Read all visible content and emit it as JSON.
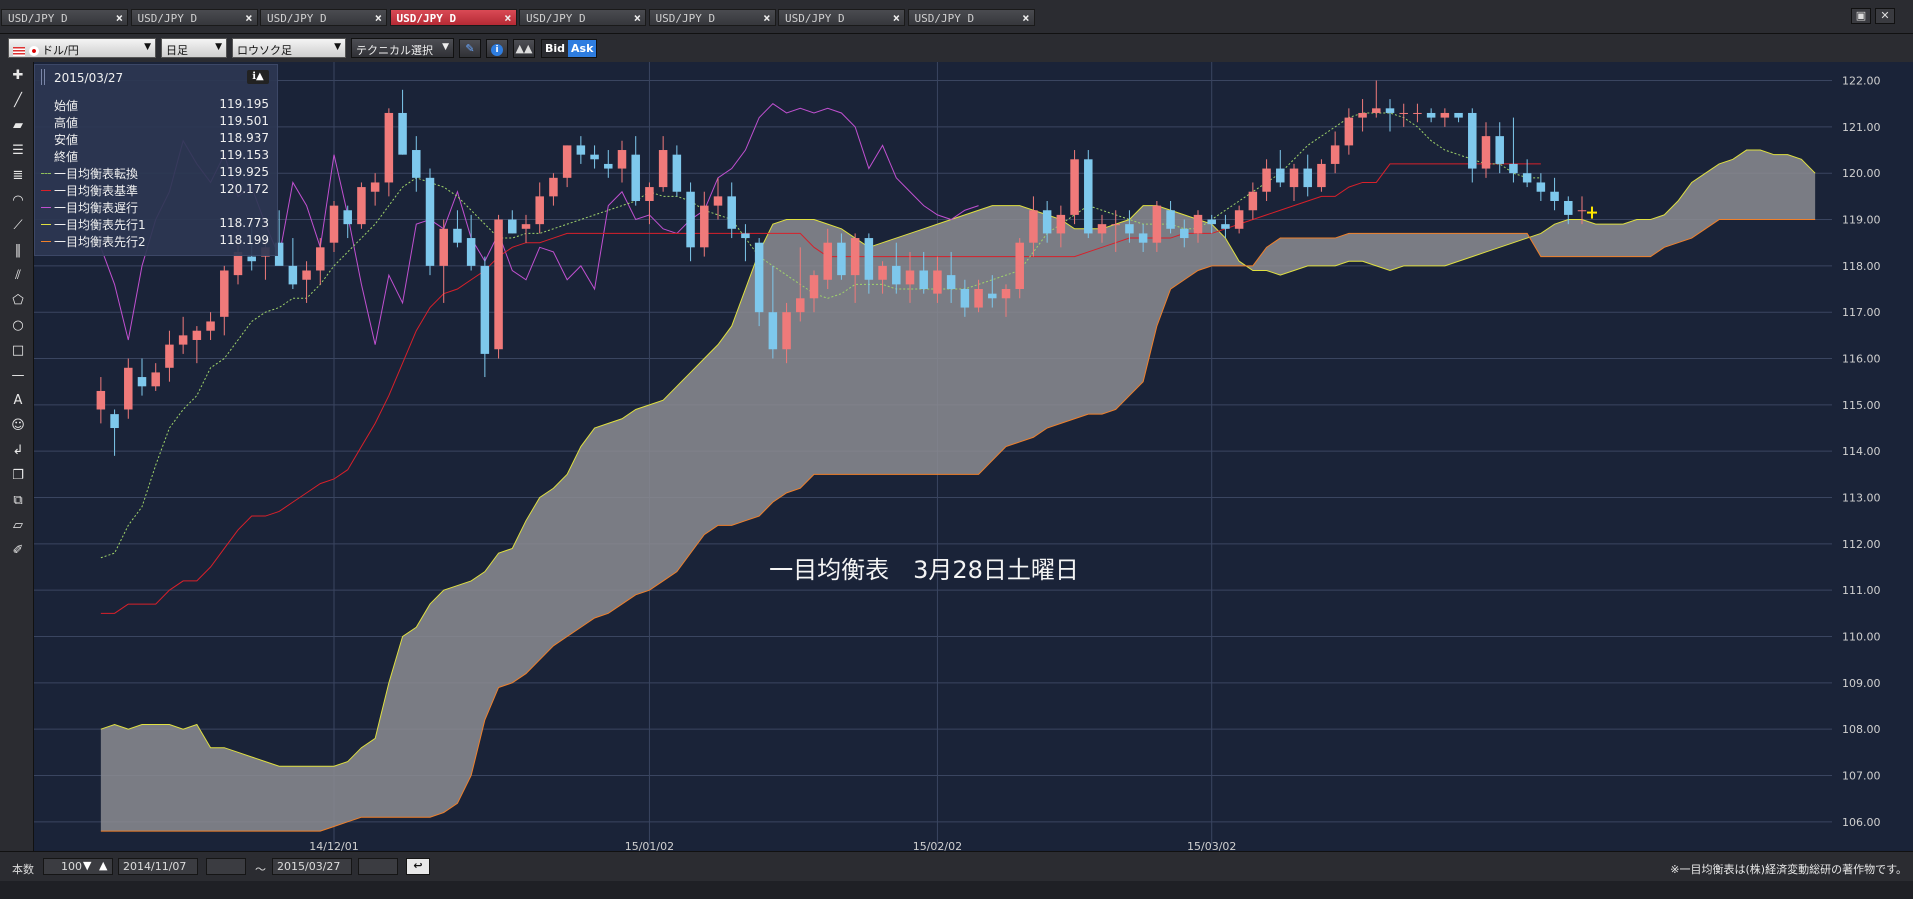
{
  "tabs": [
    {
      "label": "USD/JPY D",
      "active": false
    },
    {
      "label": "USD/JPY D",
      "active": false
    },
    {
      "label": "USD/JPY D",
      "active": false
    },
    {
      "label": "USD/JPY D",
      "active": true
    },
    {
      "label": "USD/JPY D",
      "active": false
    },
    {
      "label": "USD/JPY D",
      "active": false
    },
    {
      "label": "USD/JPY D",
      "active": false
    },
    {
      "label": "USD/JPY D",
      "active": false
    }
  ],
  "toolbar": {
    "currency": "ドル/円",
    "period": "日足",
    "chart_style": "ロウソク足",
    "technical": "テクニカル選択",
    "bid": "Bid",
    "ask": "Ask"
  },
  "info_panel": {
    "date": "2015/03/27",
    "rows": [
      {
        "label": "始値",
        "value": "119.195"
      },
      {
        "label": "高値",
        "value": "119.501"
      },
      {
        "label": "安値",
        "value": "118.937"
      },
      {
        "label": "終値",
        "value": "119.153"
      },
      {
        "label": "一目均衡表転換",
        "value": "119.925"
      },
      {
        "label": "一目均衡表基準",
        "value": "120.172"
      },
      {
        "label": "一目均衡表遅行",
        "value": ""
      },
      {
        "label": "一目均衡表先行1",
        "value": "118.773"
      },
      {
        "label": "一目均衡表先行2",
        "value": "118.199"
      }
    ]
  },
  "chart_annotation": "一目均衡表　3月28日土曜日",
  "copyright": "※一目均衡表は(株)経済変動総研の著作物です。",
  "bottom": {
    "count_label": "本数",
    "count_value": "100",
    "date_from": "2014/11/07",
    "tilde": "～",
    "date_to": "2015/03/27"
  },
  "colors": {
    "background": "#1a2338",
    "grid": "#3a4560",
    "bull": "#f07a7a",
    "bear": "#7ec8ec",
    "tenkan": "#9fd36a",
    "kijun": "#d8202a",
    "chikou": "#c050d0",
    "senkou1": "#e0e040",
    "senkou2": "#f0802a",
    "cloud": "#8c8c92"
  },
  "chart_data": {
    "type": "candlestick",
    "y_ticks": [
      "122.00",
      "121.00",
      "120.00",
      "119.00",
      "118.00",
      "117.00",
      "116.00",
      "115.00",
      "114.00",
      "113.00",
      "112.00",
      "111.00",
      "110.00",
      "109.00",
      "108.00",
      "107.00",
      "106.00"
    ],
    "ylim": [
      105.5,
      122.4
    ],
    "x_ticks": [
      {
        "label": "14/12/01",
        "index": 17
      },
      {
        "label": "15/01/02",
        "index": 40
      },
      {
        "label": "15/02/02",
        "index": 61
      },
      {
        "label": "15/03/02",
        "index": 81
      }
    ],
    "total_slots": 126,
    "candles": [
      [
        114.9,
        115.6,
        114.6,
        115.3
      ],
      [
        114.8,
        114.9,
        113.9,
        114.5
      ],
      [
        114.9,
        116.0,
        114.7,
        115.8
      ],
      [
        115.6,
        116.0,
        115.2,
        115.4
      ],
      [
        115.4,
        115.9,
        115.3,
        115.7
      ],
      [
        115.8,
        116.6,
        115.5,
        116.3
      ],
      [
        116.3,
        116.9,
        116.1,
        116.5
      ],
      [
        116.4,
        116.7,
        115.9,
        116.6
      ],
      [
        116.6,
        117.0,
        116.4,
        116.8
      ],
      [
        116.9,
        118.0,
        116.5,
        117.9
      ],
      [
        117.8,
        118.5,
        117.6,
        118.3
      ],
      [
        118.2,
        118.9,
        117.9,
        118.1
      ],
      [
        118.2,
        118.6,
        117.7,
        118.4
      ],
      [
        118.5,
        119.2,
        118.2,
        118.0
      ],
      [
        118.0,
        118.6,
        117.5,
        117.6
      ],
      [
        117.7,
        118.1,
        117.2,
        117.9
      ],
      [
        117.9,
        118.6,
        117.6,
        118.4
      ],
      [
        118.5,
        119.4,
        118.3,
        119.3
      ],
      [
        119.2,
        119.3,
        118.6,
        118.9
      ],
      [
        118.9,
        119.8,
        118.8,
        119.7
      ],
      [
        119.6,
        120.0,
        119.3,
        119.8
      ],
      [
        119.8,
        121.4,
        119.5,
        121.3
      ],
      [
        121.3,
        121.8,
        120.4,
        120.4
      ],
      [
        120.5,
        120.8,
        119.6,
        119.9
      ],
      [
        119.9,
        120.1,
        117.8,
        118.0
      ],
      [
        118.0,
        119.0,
        117.2,
        118.8
      ],
      [
        118.8,
        119.2,
        118.4,
        118.5
      ],
      [
        118.6,
        119.1,
        117.9,
        118.0
      ],
      [
        118.0,
        118.2,
        115.6,
        116.1
      ],
      [
        116.2,
        119.1,
        116.0,
        119.0
      ],
      [
        119.0,
        119.2,
        118.7,
        118.7
      ],
      [
        118.8,
        119.1,
        118.5,
        118.9
      ],
      [
        118.9,
        119.8,
        118.7,
        119.5
      ],
      [
        119.5,
        120.0,
        119.3,
        119.9
      ],
      [
        119.9,
        120.6,
        119.7,
        120.6
      ],
      [
        120.6,
        120.8,
        120.2,
        120.4
      ],
      [
        120.4,
        120.6,
        120.1,
        120.3
      ],
      [
        120.2,
        120.5,
        119.9,
        120.1
      ],
      [
        120.1,
        120.7,
        119.8,
        120.5
      ],
      [
        120.4,
        120.8,
        119.3,
        119.4
      ],
      [
        119.4,
        119.8,
        118.9,
        119.7
      ],
      [
        119.7,
        120.8,
        119.6,
        120.5
      ],
      [
        120.4,
        120.6,
        119.5,
        119.6
      ],
      [
        119.6,
        119.8,
        118.1,
        118.4
      ],
      [
        118.4,
        119.6,
        118.2,
        119.3
      ],
      [
        119.3,
        119.9,
        119.0,
        119.5
      ],
      [
        119.5,
        119.8,
        118.6,
        118.8
      ],
      [
        118.7,
        118.9,
        118.1,
        118.6
      ],
      [
        118.5,
        118.6,
        116.7,
        117.0
      ],
      [
        117.0,
        118.0,
        116.0,
        116.2
      ],
      [
        116.2,
        117.2,
        115.9,
        117.0
      ],
      [
        117.0,
        118.4,
        116.8,
        117.3
      ],
      [
        117.3,
        117.9,
        117.0,
        117.8
      ],
      [
        117.7,
        118.8,
        117.5,
        118.5
      ],
      [
        118.5,
        118.7,
        117.7,
        117.8
      ],
      [
        117.8,
        118.7,
        117.2,
        118.6
      ],
      [
        118.6,
        118.7,
        117.4,
        117.7
      ],
      [
        117.7,
        118.1,
        117.4,
        118.0
      ],
      [
        118.0,
        118.5,
        117.4,
        117.6
      ],
      [
        117.6,
        118.3,
        117.2,
        117.9
      ],
      [
        117.9,
        118.3,
        117.4,
        117.5
      ],
      [
        117.4,
        118.2,
        117.2,
        117.9
      ],
      [
        117.8,
        118.3,
        117.2,
        117.5
      ],
      [
        117.5,
        117.7,
        116.9,
        117.1
      ],
      [
        117.1,
        117.7,
        117.0,
        117.5
      ],
      [
        117.4,
        117.8,
        117.1,
        117.3
      ],
      [
        117.3,
        117.6,
        116.9,
        117.5
      ],
      [
        117.5,
        118.6,
        117.3,
        118.5
      ],
      [
        118.5,
        119.5,
        118.2,
        119.2
      ],
      [
        119.2,
        119.4,
        118.5,
        118.7
      ],
      [
        118.7,
        119.3,
        118.4,
        119.1
      ],
      [
        119.1,
        120.5,
        118.9,
        120.3
      ],
      [
        120.3,
        120.5,
        118.6,
        118.7
      ],
      [
        118.7,
        119.1,
        118.5,
        118.9
      ],
      [
        118.9,
        119.2,
        118.3,
        118.9
      ],
      [
        118.9,
        119.2,
        118.5,
        118.7
      ],
      [
        118.7,
        118.9,
        118.3,
        118.5
      ],
      [
        118.5,
        119.4,
        118.3,
        119.3
      ],
      [
        119.2,
        119.4,
        118.7,
        118.8
      ],
      [
        118.8,
        119.0,
        118.4,
        118.6
      ],
      [
        118.7,
        119.2,
        118.5,
        119.1
      ],
      [
        119.0,
        119.1,
        118.7,
        118.9
      ],
      [
        118.9,
        119.1,
        118.6,
        118.8
      ],
      [
        118.8,
        119.3,
        118.7,
        119.2
      ],
      [
        119.2,
        119.8,
        119.0,
        119.6
      ],
      [
        119.6,
        120.3,
        119.4,
        120.1
      ],
      [
        120.1,
        120.5,
        119.7,
        119.8
      ],
      [
        119.7,
        120.2,
        119.4,
        120.1
      ],
      [
        120.1,
        120.4,
        119.5,
        119.7
      ],
      [
        119.7,
        120.3,
        119.6,
        120.2
      ],
      [
        120.2,
        120.9,
        120.0,
        120.6
      ],
      [
        120.6,
        121.4,
        120.4,
        121.2
      ],
      [
        121.2,
        121.6,
        120.9,
        121.3
      ],
      [
        121.3,
        122.0,
        121.2,
        121.4
      ],
      [
        121.4,
        121.6,
        120.9,
        121.3
      ],
      [
        121.3,
        121.5,
        121.0,
        121.3
      ],
      [
        121.3,
        121.5,
        121.1,
        121.3
      ],
      [
        121.3,
        121.4,
        121.1,
        121.2
      ],
      [
        121.2,
        121.4,
        121.0,
        121.3
      ],
      [
        121.3,
        121.3,
        121.1,
        121.2
      ],
      [
        121.3,
        121.4,
        119.8,
        120.1
      ],
      [
        120.1,
        121.1,
        119.9,
        120.8
      ],
      [
        120.8,
        121.1,
        120.0,
        120.2
      ],
      [
        120.2,
        121.2,
        119.8,
        120.0
      ],
      [
        120.0,
        120.3,
        119.7,
        119.8
      ],
      [
        119.8,
        120.0,
        119.4,
        119.6
      ],
      [
        119.6,
        119.9,
        119.2,
        119.4
      ],
      [
        119.4,
        119.5,
        118.9,
        119.1
      ],
      [
        119.2,
        119.5,
        118.9,
        119.2
      ]
    ],
    "tenkan": [
      111.7,
      111.8,
      112.4,
      112.8,
      113.7,
      114.5,
      114.9,
      115.2,
      115.8,
      116.0,
      116.4,
      116.8,
      117.0,
      117.1,
      117.3,
      117.3,
      117.6,
      118.0,
      118.3,
      118.6,
      118.9,
      119.3,
      119.7,
      119.9,
      119.8,
      119.7,
      119.5,
      119.2,
      118.9,
      118.6,
      118.6,
      118.7,
      118.7,
      118.8,
      118.9,
      119.0,
      119.1,
      119.2,
      119.3,
      119.4,
      119.6,
      119.5,
      119.5,
      119.4,
      119.2,
      119.1,
      119.0,
      118.6,
      118.2,
      118.0,
      117.8,
      117.6,
      117.4,
      117.3,
      117.4,
      117.6,
      117.6,
      117.6,
      117.5,
      117.5,
      117.5,
      117.5,
      117.5,
      117.5,
      117.6,
      117.7,
      117.8,
      117.9,
      118.3,
      118.7,
      118.9,
      119.1,
      119.3,
      119.2,
      119.1,
      119.0,
      118.9,
      118.9,
      118.9,
      118.8,
      118.8,
      119.0,
      119.2,
      119.4,
      119.6,
      119.8,
      120.0,
      120.3,
      120.6,
      120.8,
      121.0,
      121.2,
      121.3,
      121.3,
      121.3,
      121.2,
      121.0,
      120.7,
      120.5,
      120.4,
      120.3,
      120.2,
      120.2,
      120.0,
      119.9,
      119.9
    ],
    "kijun": [
      110.5,
      110.5,
      110.7,
      110.7,
      110.7,
      111.0,
      111.2,
      111.2,
      111.5,
      111.9,
      112.3,
      112.6,
      112.6,
      112.7,
      112.9,
      113.1,
      113.3,
      113.4,
      113.6,
      114.1,
      114.6,
      115.2,
      115.9,
      116.6,
      117.1,
      117.4,
      117.5,
      117.7,
      117.9,
      118.2,
      118.4,
      118.5,
      118.5,
      118.6,
      118.7,
      118.7,
      118.7,
      118.7,
      118.7,
      118.7,
      118.7,
      118.7,
      118.7,
      118.7,
      118.7,
      118.7,
      118.7,
      118.7,
      118.7,
      118.7,
      118.7,
      118.7,
      118.4,
      118.2,
      118.2,
      118.2,
      118.2,
      118.2,
      118.2,
      118.2,
      118.2,
      118.2,
      118.2,
      118.2,
      118.2,
      118.2,
      118.2,
      118.2,
      118.2,
      118.2,
      118.2,
      118.2,
      118.3,
      118.4,
      118.5,
      118.6,
      118.6,
      118.6,
      118.6,
      118.7,
      118.7,
      118.7,
      118.8,
      118.9,
      119.0,
      119.1,
      119.2,
      119.3,
      119.4,
      119.5,
      119.5,
      119.7,
      119.8,
      119.8,
      120.2,
      120.2,
      120.2,
      120.2,
      120.2,
      120.2,
      120.2,
      120.2,
      120.2,
      120.2,
      120.2,
      120.2
    ],
    "chikou": [
      118.4,
      117.6,
      116.4,
      118.0,
      119.0,
      119.6,
      120.7,
      120.2,
      119.8,
      120.4,
      119.5,
      119.7,
      118.9,
      118.2,
      119.8,
      119.3,
      118.4,
      120.4,
      119.1,
      117.6,
      116.3,
      117.8,
      117.2,
      118.9,
      119.0,
      118.8,
      119.6,
      118.6,
      118.1,
      118.7,
      117.9,
      117.7,
      118.4,
      118.3,
      117.7,
      118.0,
      117.5,
      119.3,
      119.6,
      119.0,
      119.1,
      118.8,
      118.7,
      119.0,
      119.2,
      119.9,
      120.1,
      120.5,
      121.2,
      121.5,
      121.3,
      121.4,
      121.3,
      121.4,
      121.3,
      121.0,
      120.1,
      120.6,
      119.9,
      119.6,
      119.3,
      119.1,
      119.0,
      119.2,
      119.3
    ],
    "senkou1": [
      108.0,
      108.1,
      108.0,
      108.1,
      108.1,
      108.1,
      108.0,
      108.1,
      107.6,
      107.6,
      107.5,
      107.4,
      107.3,
      107.2,
      107.2,
      107.2,
      107.2,
      107.2,
      107.3,
      107.6,
      107.8,
      109.0,
      110.0,
      110.2,
      110.7,
      111.0,
      111.1,
      111.2,
      111.4,
      111.8,
      111.9,
      112.5,
      113.0,
      113.2,
      113.5,
      114.1,
      114.5,
      114.6,
      114.7,
      114.9,
      115.0,
      115.1,
      115.4,
      115.7,
      116.0,
      116.3,
      116.7,
      117.5,
      118.3,
      118.9,
      119.0,
      119.0,
      119.0,
      118.9,
      118.8,
      118.6,
      118.4,
      118.5,
      118.6,
      118.7,
      118.8,
      118.9,
      119.0,
      119.1,
      119.2,
      119.3,
      119.3,
      119.3,
      119.2,
      119.1,
      119.0,
      118.8,
      118.8,
      118.8,
      118.9,
      119.0,
      119.3,
      119.3,
      119.2,
      119.1,
      119.0,
      118.9,
      118.6,
      118.1,
      117.9,
      117.9,
      117.8,
      117.9,
      118.0,
      118.0,
      118.0,
      118.1,
      118.1,
      118.0,
      117.9,
      118.0,
      118.0,
      118.0,
      118.0,
      118.1,
      118.2,
      118.3,
      118.4,
      118.5,
      118.6,
      118.7,
      118.9,
      119.0,
      119.0,
      118.9,
      118.9,
      118.9,
      119.0,
      119.0,
      119.1,
      119.4,
      119.8,
      120.0,
      120.2,
      120.3,
      120.5,
      120.5,
      120.4,
      120.4,
      120.3,
      120.0
    ],
    "senkou2": [
      105.8,
      105.8,
      105.8,
      105.8,
      105.8,
      105.8,
      105.8,
      105.8,
      105.8,
      105.8,
      105.8,
      105.8,
      105.8,
      105.8,
      105.8,
      105.8,
      105.8,
      105.9,
      106.0,
      106.1,
      106.1,
      106.1,
      106.1,
      106.1,
      106.1,
      106.2,
      106.4,
      107.0,
      108.2,
      108.9,
      109.0,
      109.2,
      109.5,
      109.8,
      110.0,
      110.2,
      110.4,
      110.5,
      110.7,
      110.9,
      111.0,
      111.2,
      111.4,
      111.8,
      112.2,
      112.4,
      112.4,
      112.5,
      112.6,
      112.9,
      113.1,
      113.2,
      113.5,
      113.5,
      113.5,
      113.5,
      113.5,
      113.5,
      113.5,
      113.5,
      113.5,
      113.5,
      113.5,
      113.5,
      113.5,
      113.8,
      114.1,
      114.2,
      114.3,
      114.5,
      114.6,
      114.7,
      114.8,
      114.8,
      114.9,
      115.2,
      115.5,
      116.7,
      117.5,
      117.7,
      117.9,
      118.0,
      118.0,
      118.0,
      118.0,
      118.4,
      118.6,
      118.6,
      118.6,
      118.6,
      118.6,
      118.7,
      118.7,
      118.7,
      118.7,
      118.7,
      118.7,
      118.7,
      118.7,
      118.7,
      118.7,
      118.7,
      118.7,
      118.7,
      118.7,
      118.2,
      118.2,
      118.2,
      118.2,
      118.2,
      118.2,
      118.2,
      118.2,
      118.2,
      118.4,
      118.5,
      118.6,
      118.8,
      119.0,
      119.0,
      119.0,
      119.0,
      119.0,
      119.0,
      119.0,
      119.0
    ]
  }
}
